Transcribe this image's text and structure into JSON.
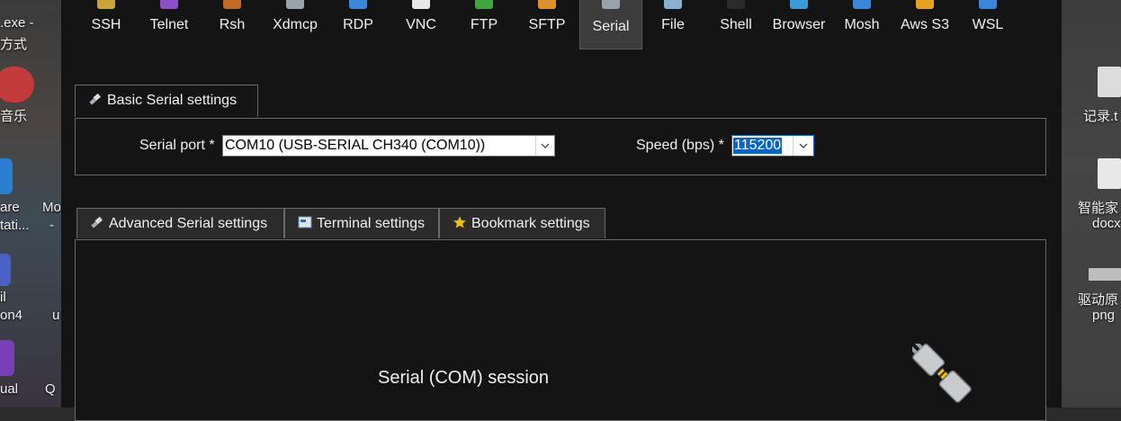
{
  "desktop": {
    "left_texts": [
      ".exe -",
      "方式",
      "音乐",
      "are",
      "tati...",
      "Mo",
      "-",
      "il",
      "on4",
      "u",
      "ual",
      "Q"
    ],
    "right_texts": [
      "记录.t",
      "智能家",
      "docx",
      "驱动原",
      "png"
    ]
  },
  "toolbar": {
    "items": [
      {
        "label": "SSH",
        "icon": "ssh-icon",
        "color": "#c9a43a"
      },
      {
        "label": "Telnet",
        "icon": "telnet-icon",
        "color": "#8a4fc9"
      },
      {
        "label": "Rsh",
        "icon": "rsh-icon",
        "color": "#c06a2a"
      },
      {
        "label": "Xdmcp",
        "icon": "xdmcp-icon",
        "color": "#9aa3ad"
      },
      {
        "label": "RDP",
        "icon": "rdp-icon",
        "color": "#3a86d8"
      },
      {
        "label": "VNC",
        "icon": "vnc-icon",
        "color": "#e8e8e8"
      },
      {
        "label": "FTP",
        "icon": "ftp-icon",
        "color": "#3fa63f"
      },
      {
        "label": "SFTP",
        "icon": "sftp-icon",
        "color": "#e0902a"
      },
      {
        "label": "Serial",
        "icon": "serial-icon",
        "color": "#9aa3ad"
      },
      {
        "label": "File",
        "icon": "file-icon",
        "color": "#8ab0d0"
      },
      {
        "label": "Shell",
        "icon": "shell-icon",
        "color": "#2a2a2a"
      },
      {
        "label": "Browser",
        "icon": "browser-icon",
        "color": "#3a9ad8"
      },
      {
        "label": "Mosh",
        "icon": "mosh-icon",
        "color": "#3a86d8"
      },
      {
        "label": "Aws S3",
        "icon": "aws-s3-icon",
        "color": "#e8a020"
      },
      {
        "label": "WSL",
        "icon": "wsl-icon",
        "color": "#3a86d8"
      }
    ],
    "active": "Serial"
  },
  "basic": {
    "tab_label": "Basic Serial settings",
    "serial_port_label": "Serial port *",
    "serial_port_value": "COM10  (USB-SERIAL CH340 (COM10))",
    "speed_label": "Speed (bps) *",
    "speed_value": "115200"
  },
  "tabs": [
    {
      "label": "Advanced Serial settings",
      "icon": "plug-icon"
    },
    {
      "label": "Terminal settings",
      "icon": "terminal-icon"
    },
    {
      "label": "Bookmark settings",
      "icon": "star-icon"
    }
  ],
  "session_title": "Serial (COM) session",
  "colors": {
    "accent_selection": "#0a64c8",
    "star": "#f2c200"
  }
}
